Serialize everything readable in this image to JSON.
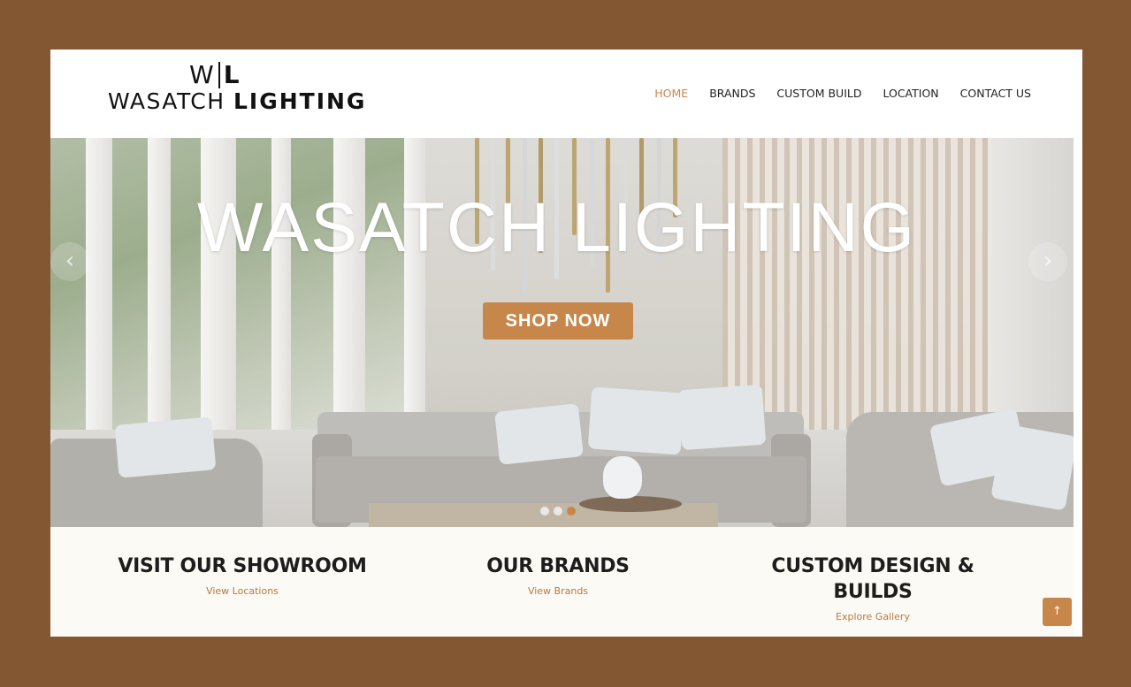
{
  "logo": {
    "mark_left": "W",
    "mark_right": "L",
    "word_regular": "WASATCH",
    "word_bold": "LIGHTING"
  },
  "nav": {
    "items": [
      {
        "label": "HOME",
        "active": true
      },
      {
        "label": "BRANDS",
        "active": false
      },
      {
        "label": "CUSTOM BUILD",
        "active": false
      },
      {
        "label": "LOCATION",
        "active": false
      },
      {
        "label": "CONTACT US",
        "active": false
      }
    ]
  },
  "hero": {
    "title": "WASATCH LIGHTING",
    "button_label": "SHOP NOW",
    "prev_icon": "chevron-left-icon",
    "next_icon": "chevron-right-icon",
    "slides": 3,
    "active_slide": 3
  },
  "features": [
    {
      "title": "VISIT OUR SHOWROOM",
      "link": "View Locations"
    },
    {
      "title": "OUR BRANDS",
      "link": "View Brands"
    },
    {
      "title": "CUSTOM DESIGN & BUILDS",
      "link": "Explore Gallery"
    }
  ],
  "scroll_top": {
    "icon": "arrow-up-icon"
  },
  "colors": {
    "background": "#835731",
    "accent": "#c8874a",
    "features_bg": "#fcfaf4",
    "text_dark": "#1d1d1d"
  }
}
